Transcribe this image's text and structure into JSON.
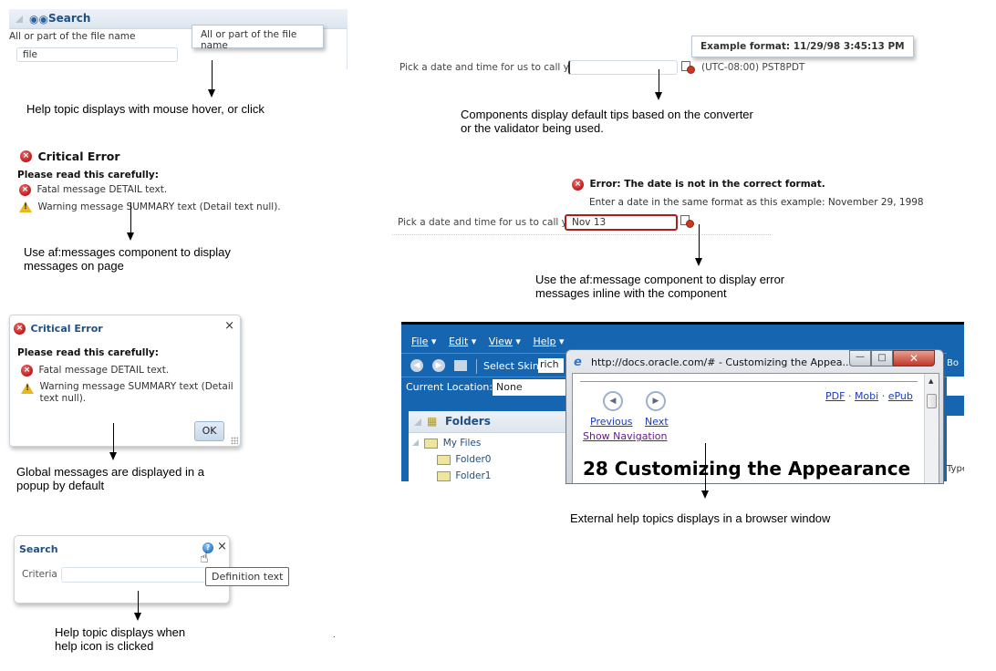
{
  "panel_search": {
    "title": "Search",
    "field_label": "All or part of the file name",
    "field_value": "file",
    "tooltip": "All or part of the file name",
    "caption": "Help topic displays with mouse hover, or click"
  },
  "messages_inline": {
    "title": "Critical Error",
    "intro": "Please read this carefully:",
    "items": [
      {
        "type": "error",
        "text": "Fatal message DETAIL text."
      },
      {
        "type": "warning",
        "text": "Warning message SUMMARY text (Detail text null)."
      }
    ],
    "caption_line1": "Use af:messages component to display",
    "caption_line2": "messages on page"
  },
  "messages_popup": {
    "title": "Critical Error",
    "close": "×",
    "intro": "Please read this carefully:",
    "items": [
      {
        "type": "error",
        "text": "Fatal message DETAIL text."
      },
      {
        "type": "warning",
        "text_line1": "Warning message SUMMARY text (Detail",
        "text_line2": "text null)."
      }
    ],
    "ok_label": "OK",
    "caption_line1": "Global messages are displayed in a",
    "caption_line2": "popup by default"
  },
  "help_dialog": {
    "title": "Search",
    "close": "×",
    "criteria_label": "Criteria",
    "criteria_value": "",
    "tooltip": "Definition text",
    "caption_line1": "Help topic displays when",
    "caption_line2": "help icon is clicked"
  },
  "date_tip": {
    "label": "Pick a date and time for us to call you",
    "value": "",
    "tooltip": "Example format: 11/29/98 3:45:13 PM",
    "timezone": "(UTC-08:00) PST8PDT",
    "caption_line1": "Components display default tips based on the converter",
    "caption_line2": "or the validator being used."
  },
  "date_error": {
    "error_title": "Error: The date is not in the correct format.",
    "error_detail": "Enter a date in the same format as this example: November 29, 1998",
    "label": "Pick a date and time for us to call you",
    "value": "Nov 13",
    "error_color": "#b01c1c",
    "caption_line1": "Use the af:message component to display error",
    "caption_line2": "messages inline with the component"
  },
  "app_window": {
    "menu": [
      "File",
      "Edit",
      "View",
      "Help"
    ],
    "select_skin_label": "Select Skin",
    "skin_value": "rich",
    "current_location_label": "Current Location:",
    "current_location_value": "None",
    "folders_title": "Folders",
    "tree": [
      {
        "label": "My Files",
        "level": 0
      },
      {
        "label": "Folder0",
        "level": 1
      },
      {
        "label": "Folder1",
        "level": 1
      }
    ],
    "right_edge_text": "Bo",
    "right_edge_type": "Type",
    "accent": "#1565b0"
  },
  "browser_popup": {
    "title": "http://docs.oracle.com/# - Customizing the Appea...",
    "prev_label": "Previous",
    "next_label": "Next",
    "show_nav": "Show Navigation",
    "formats": [
      "PDF",
      "Mobi",
      "ePub"
    ],
    "heading": "28 Customizing the Appearance",
    "caption": "External help topics displays in a browser window"
  }
}
